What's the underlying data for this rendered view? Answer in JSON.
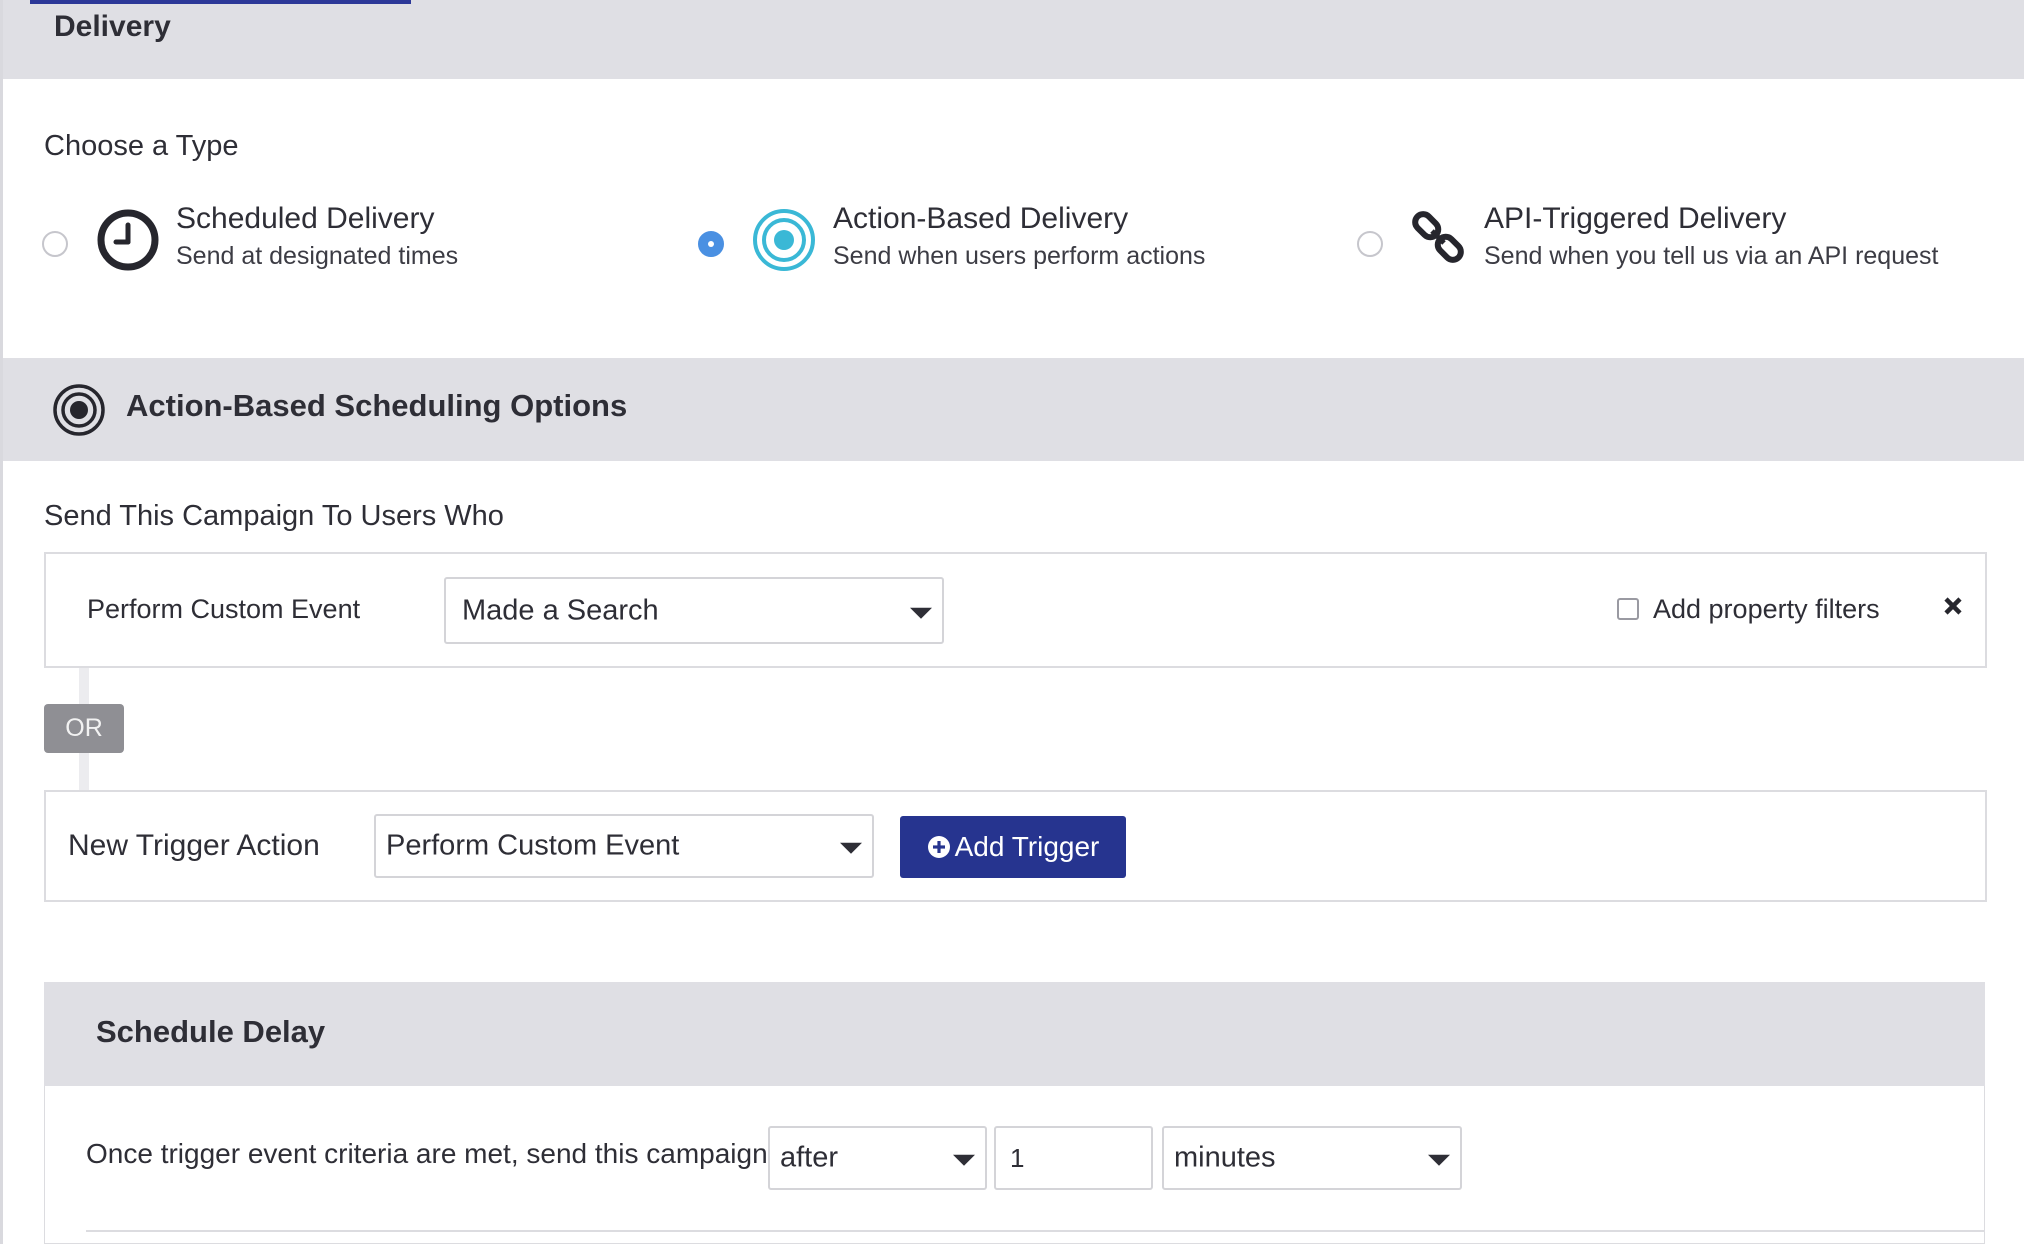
{
  "delivery": {
    "title": "Delivery"
  },
  "type_section": {
    "label": "Choose a Type",
    "options": [
      {
        "title": "Scheduled Delivery",
        "subtitle": "Send at designated times",
        "selected": false,
        "icon": "clock-icon"
      },
      {
        "title": "Action-Based Delivery",
        "subtitle": "Send when users perform actions",
        "selected": true,
        "icon": "target-icon"
      },
      {
        "title": "API-Triggered Delivery",
        "subtitle": "Send when you tell us via an API request",
        "selected": false,
        "icon": "link-icon"
      }
    ]
  },
  "scheduling": {
    "title": "Action-Based Scheduling Options",
    "send_label": "Send This Campaign To Users Who",
    "trigger": {
      "label": "Perform Custom Event",
      "event_value": "Made a Search",
      "property_filter_label": "Add property filters",
      "property_filter_checked": false
    },
    "or_label": "OR",
    "new_trigger": {
      "label": "New Trigger Action",
      "select_value": "Perform Custom Event",
      "add_button_label": "Add Trigger"
    }
  },
  "schedule_delay": {
    "title": "Schedule Delay",
    "text": "Once trigger event criteria are met, send this campaign",
    "timing_value": "after",
    "amount_value": "1",
    "unit_value": "minutes"
  },
  "colors": {
    "header_bg": "#dfdfe4",
    "primary_button": "#26348f",
    "selected_radio": "#4a90e2",
    "target_icon": "#3ab8d6",
    "or_badge": "#8f8f94"
  }
}
